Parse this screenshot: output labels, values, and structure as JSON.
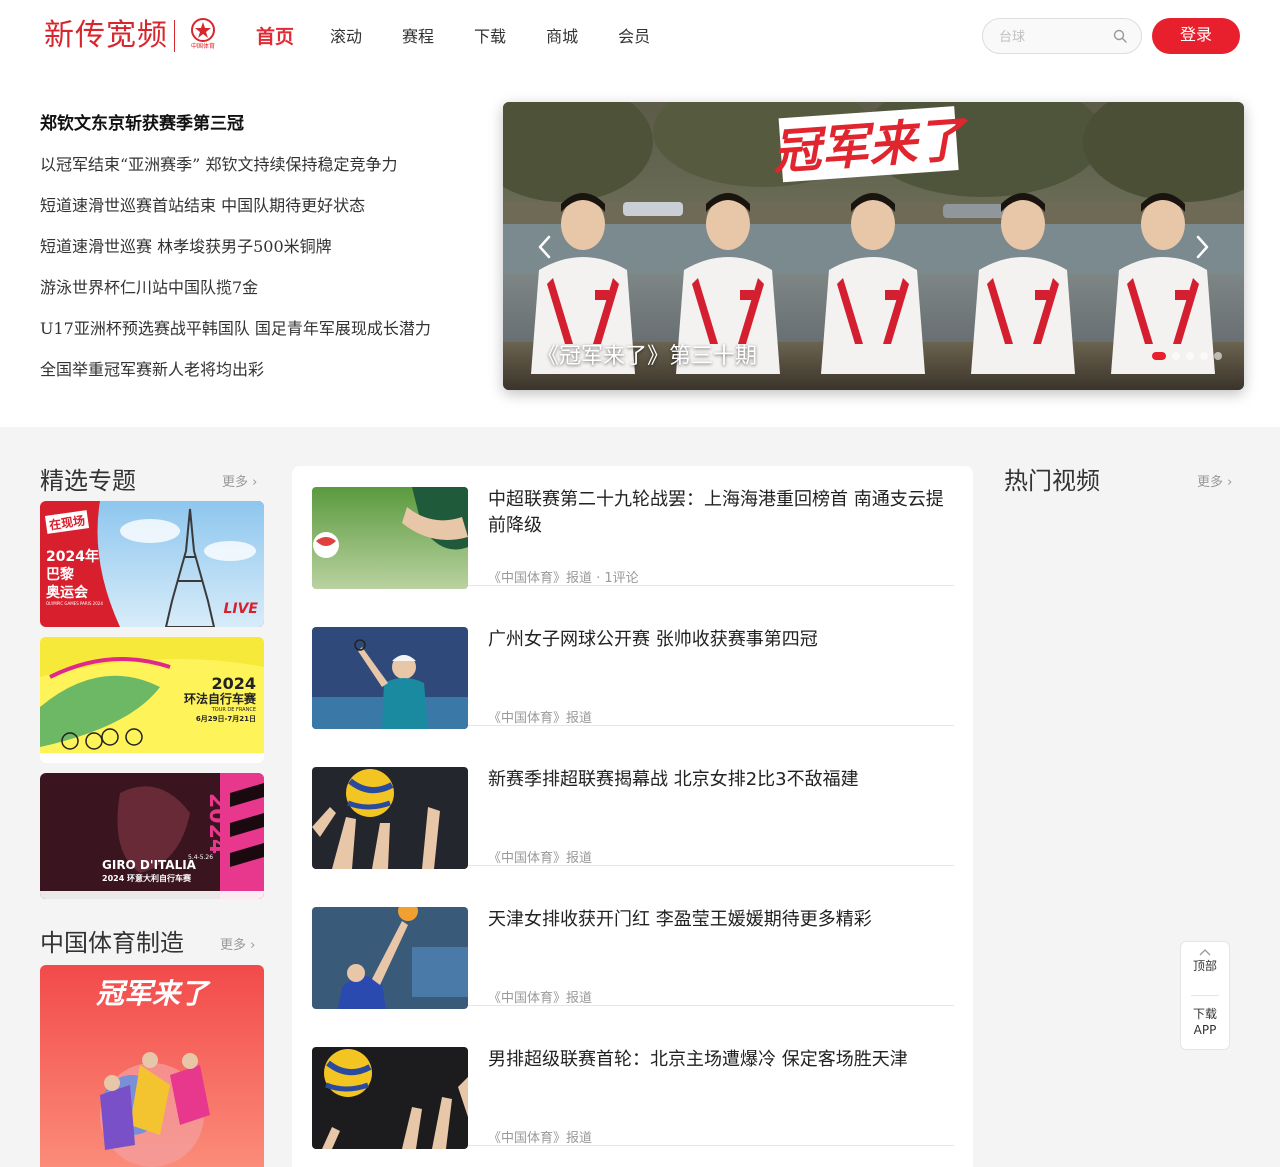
{
  "header": {
    "logo_text": "新传宽频",
    "logo_sub": "中国体育",
    "nav": [
      "首页",
      "滚动",
      "赛程",
      "下载",
      "商城",
      "会员"
    ],
    "search_placeholder": "台球",
    "login_label": "登录"
  },
  "headlines": [
    "郑钦文东京斩获赛季第三冠",
    "以冠军结束“亚洲赛季” 郑钦文持续保持稳定竞争力",
    "短道速滑世巡赛首站结束 中国队期待更好状态",
    "短道速滑世巡赛 林孝埈获男子500米铜牌",
    "游泳世界杯仁川站中国队揽7金",
    "U17亚洲杯预选赛战平韩国队 国足青年军展现成长潜力",
    "全国举重冠军赛新人老将均出彩"
  ],
  "carousel": {
    "banner_text": "冠军来了",
    "caption": "《冠军来了》第三十期",
    "slide_count": 5,
    "active_index": 0
  },
  "featured": {
    "title": "精选专题",
    "more": "更多",
    "cards": [
      {
        "name": "paris-olympics",
        "tag": "在现场",
        "text_lines": [
          "2024年",
          "巴黎",
          "奥运会"
        ],
        "sub": "OLYMPIC GAMES PARIS 2024",
        "badge": "LIVE"
      },
      {
        "name": "tour-de-france",
        "year": "2024",
        "title": "环法自行车赛",
        "sub": "TOUR DE FRANCE",
        "dates": "6月29日-7月21日"
      },
      {
        "name": "giro-italia",
        "year": "2024",
        "title": "GIRO D'ITALIA",
        "sub": "2024 环意大利自行车赛",
        "dates": "5.4-5.26"
      }
    ]
  },
  "made_in": {
    "title": "中国体育制造",
    "more": "更多",
    "card_text": "冠军来了"
  },
  "feed": [
    {
      "title": "中超联赛第二十九轮战罢：上海海港重回榜首 南通支云提前降级",
      "meta": "《中国体育》报道 · 1评论",
      "thumb": "soccer"
    },
    {
      "title": "广州女子网球公开赛 张帅收获赛事第四冠",
      "meta": "《中国体育》报道",
      "thumb": "tennis"
    },
    {
      "title": "新赛季排超联赛揭幕战 北京女排2比3不敌福建",
      "meta": "《中国体育》报道",
      "thumb": "volleyball-hands"
    },
    {
      "title": "天津女排收获开门红 李盈莹王媛媛期待更多精彩",
      "meta": "《中国体育》报道",
      "thumb": "volleyball-spike"
    },
    {
      "title": "男排超级联赛首轮：北京主场遭爆冷 保定客场胜天津",
      "meta": "《中国体育》报道",
      "thumb": "volleyball-block"
    }
  ],
  "hot_videos": {
    "title": "热门视频",
    "more": "更多"
  },
  "float_tools": {
    "top": "顶部",
    "download_1": "下载",
    "download_2": "APP"
  },
  "colors": {
    "brand_red": "#e02b36",
    "login_red": "#e8202d"
  }
}
